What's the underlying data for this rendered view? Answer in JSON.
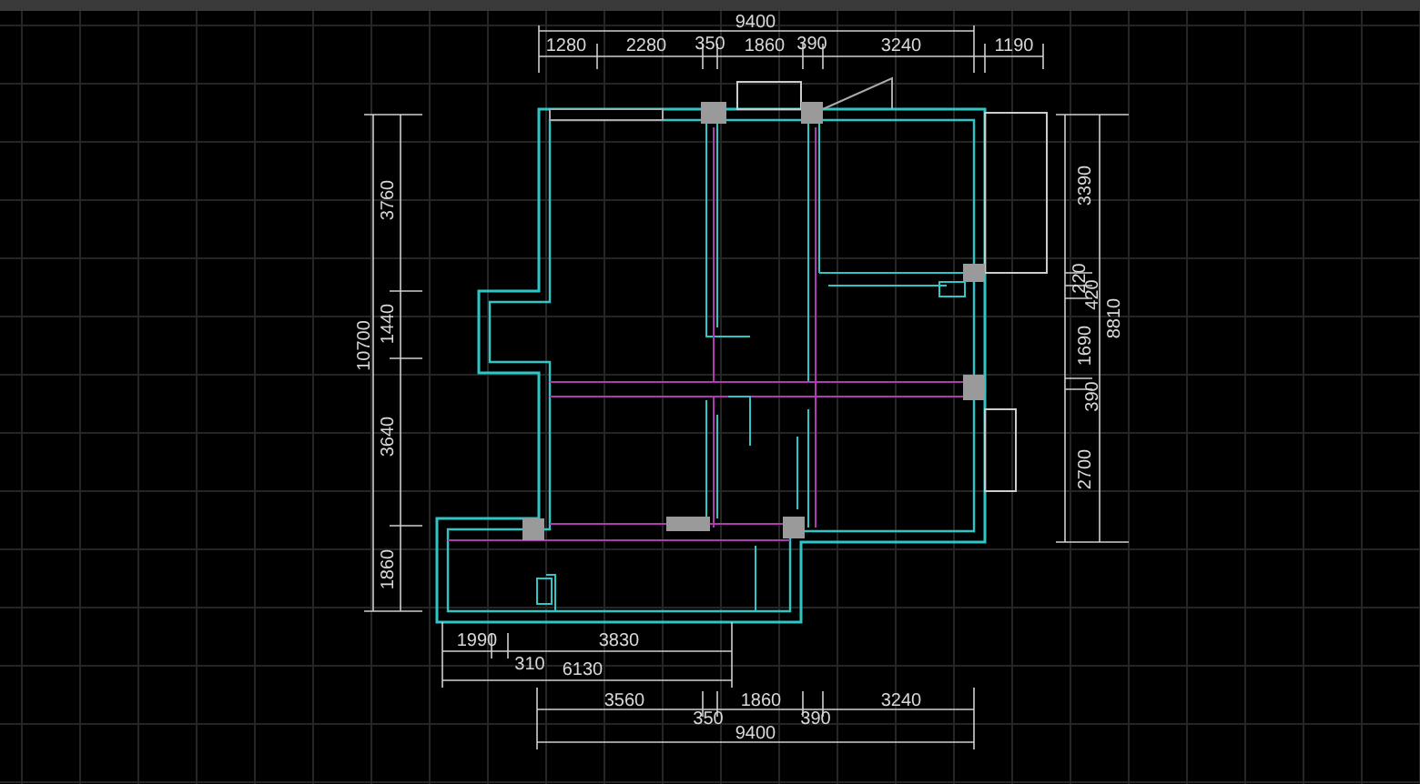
{
  "dimensions": {
    "top_total": "9400",
    "top_segments": [
      "1280",
      "2280",
      "350",
      "1860",
      "390",
      "3240",
      "1190"
    ],
    "left_total": "10700",
    "left_segments": [
      "3760",
      "1440",
      "3640",
      "1860"
    ],
    "right_total": "8810",
    "right_segments": [
      "3390",
      "220",
      "420",
      "1690",
      "390",
      "2700"
    ],
    "bottom_inner_segments": [
      "1990",
      "310",
      "3830"
    ],
    "bottom_inner_total": "6130",
    "bottom_segments": [
      "3560",
      "350",
      "1860",
      "390",
      "3240"
    ],
    "bottom_total": "9400"
  }
}
